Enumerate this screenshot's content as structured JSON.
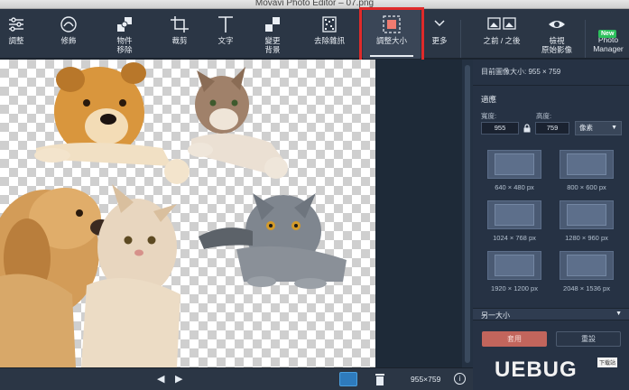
{
  "window": {
    "title": "Movavi Photo Editor – 07.png"
  },
  "toolbar": {
    "items": [
      {
        "label": "調整",
        "icon": "sliders-icon"
      },
      {
        "label": "修飾",
        "icon": "retouch-icon"
      },
      {
        "label": "物件\n移除",
        "icon": "object-removal-icon"
      },
      {
        "label": "裁剪",
        "icon": "crop-icon"
      },
      {
        "label": "文字",
        "icon": "text-icon"
      },
      {
        "label": "變更\n背景",
        "icon": "change-background-icon"
      },
      {
        "label": "去除雜訊",
        "icon": "denoise-icon"
      },
      {
        "label": "調整大小",
        "icon": "resize-icon"
      },
      {
        "label": "更多",
        "icon": "chevron-down-icon"
      },
      {
        "label": "之前 / 之後",
        "icon": "before-after-icon"
      },
      {
        "label": "檢視\n原始影像",
        "icon": "eye-icon"
      },
      {
        "label": "Photo\nManager",
        "icon": "photo-manager-icon",
        "badge": "New"
      }
    ],
    "active_index": 7
  },
  "panel": {
    "current_size": "目前圖像大小: 955 × 759",
    "section_title": "適應",
    "width_label": "寬度:",
    "height_label": "高度:",
    "width_value": "955",
    "height_value": "759",
    "unit": "像素",
    "presets": [
      "640 × 480 px",
      "800 × 600 px",
      "1024 × 768 px",
      "1280 × 960 px",
      "1920 × 1200 px",
      "2048 × 1536 px"
    ],
    "more_sizes": "另一大小",
    "apply": "套用",
    "reset": "重設"
  },
  "bottom": {
    "prev": "◀",
    "next": "▶",
    "dimensions": "955×759",
    "info": "i"
  },
  "watermark": {
    "text": "UEBUG",
    "sub": "下载站"
  },
  "colors": {
    "accent": "#2e7bbd",
    "apply_button": "#c2655c",
    "highlight_box": "#e02a2a",
    "badge": "#2cbf5c"
  }
}
